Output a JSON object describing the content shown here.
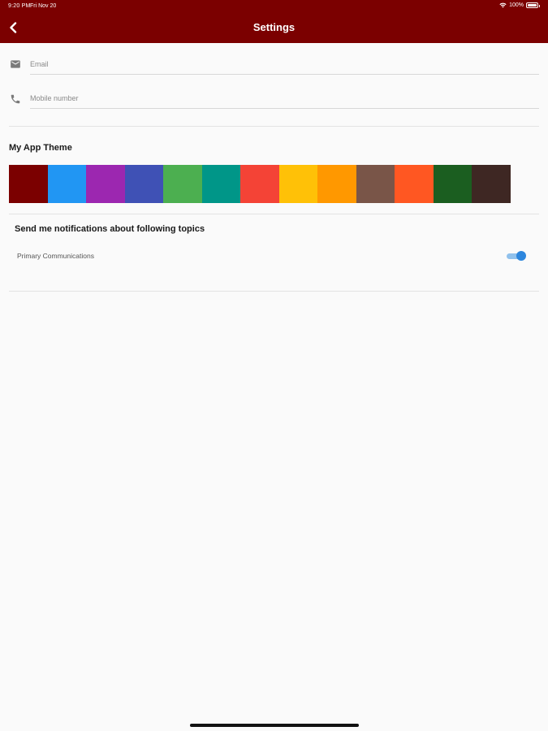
{
  "status_bar": {
    "time": "9:20 PM",
    "date": "Fri Nov 20",
    "battery": "100%"
  },
  "header": {
    "title": "Settings",
    "back_icon": "chevron-left-icon",
    "background_color": "#7b0000"
  },
  "form": {
    "email": {
      "placeholder": "Email",
      "value": "",
      "icon": "envelope-icon"
    },
    "mobile": {
      "placeholder": "Mobile number",
      "value": "",
      "icon": "phone-icon"
    }
  },
  "theme": {
    "title": "My App Theme",
    "colors": [
      "#7b0000",
      "#2196f3",
      "#9c27b0",
      "#3f51b5",
      "#4caf50",
      "#009688",
      "#f44336",
      "#ffc107",
      "#ff9800",
      "#795548",
      "#ff5722",
      "#1b5e20",
      "#3e2723"
    ]
  },
  "notifications": {
    "title": "Send me notifications about following topics",
    "topics": [
      {
        "label": "Primary Communications",
        "enabled": true
      }
    ],
    "toggle_color": "#2d86dd"
  }
}
